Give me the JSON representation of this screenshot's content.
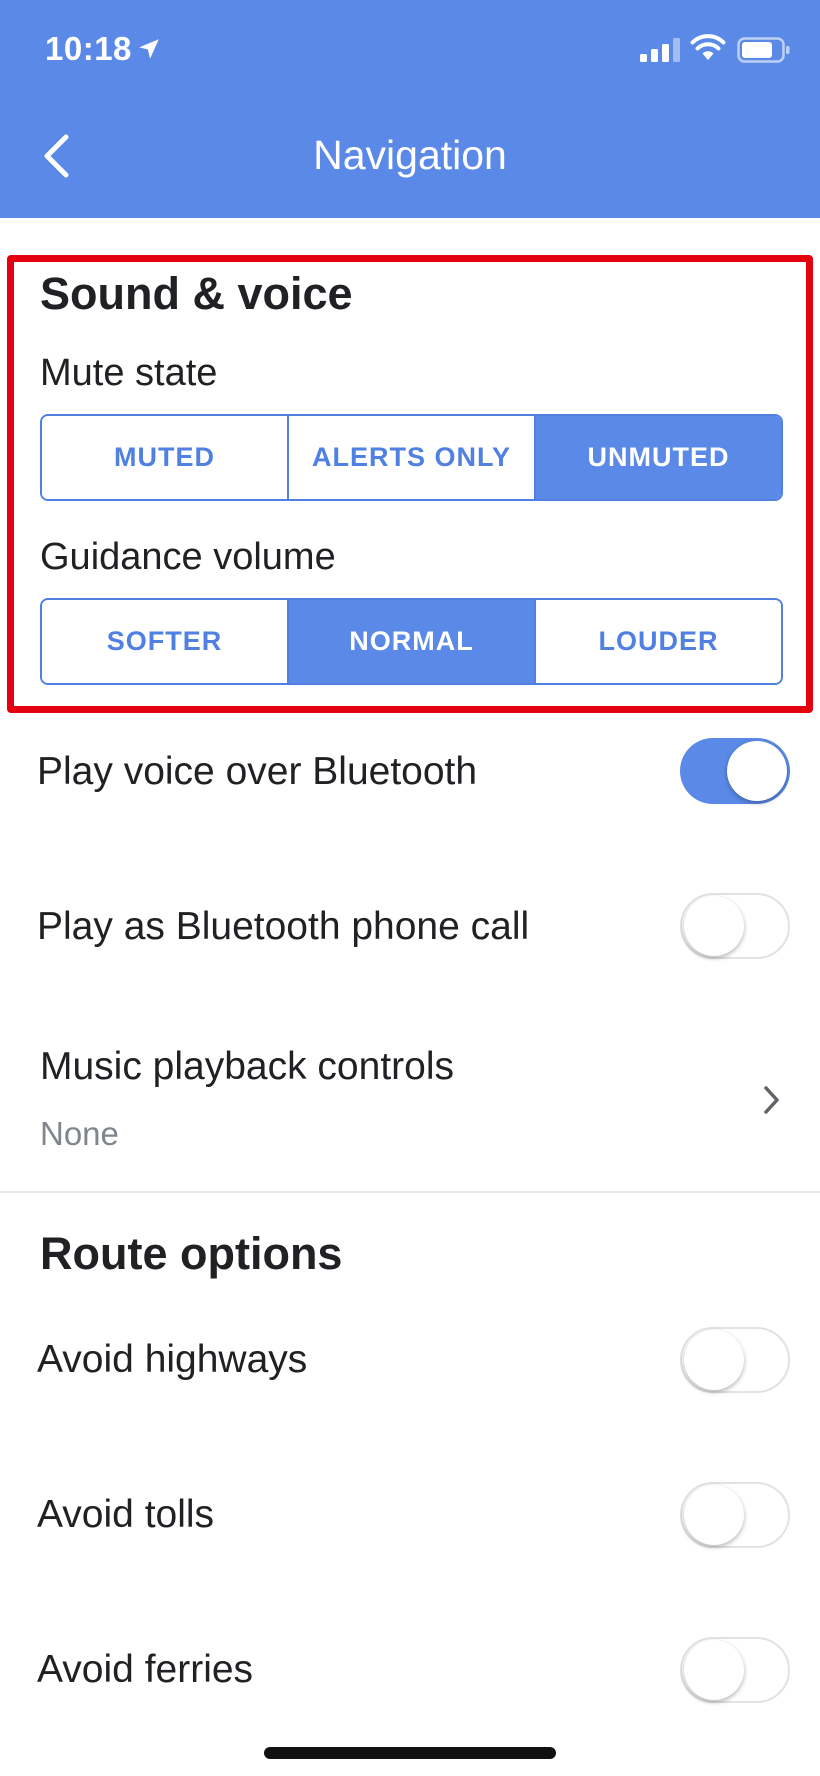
{
  "status_bar": {
    "time": "10:18"
  },
  "header": {
    "title": "Navigation"
  },
  "sound_voice": {
    "title": "Sound & voice",
    "mute_state": {
      "label": "Mute state",
      "options": [
        "MUTED",
        "ALERTS ONLY",
        "UNMUTED"
      ],
      "selected": "UNMUTED"
    },
    "guidance_volume": {
      "label": "Guidance volume",
      "options": [
        "SOFTER",
        "NORMAL",
        "LOUDER"
      ],
      "selected": "NORMAL"
    }
  },
  "settings": {
    "play_voice_bluetooth": {
      "label": "Play voice over Bluetooth",
      "on": true
    },
    "play_bluetooth_call": {
      "label": "Play as Bluetooth phone call",
      "on": false
    },
    "music_playback": {
      "label": "Music playback controls",
      "value": "None"
    }
  },
  "route_options": {
    "title": "Route options",
    "avoid_highways": {
      "label": "Avoid highways",
      "on": false
    },
    "avoid_tolls": {
      "label": "Avoid tolls",
      "on": false
    },
    "avoid_ferries": {
      "label": "Avoid ferries",
      "on": false
    }
  },
  "colors": {
    "accent": "#5a89e8",
    "highlight": "#e5000f"
  }
}
